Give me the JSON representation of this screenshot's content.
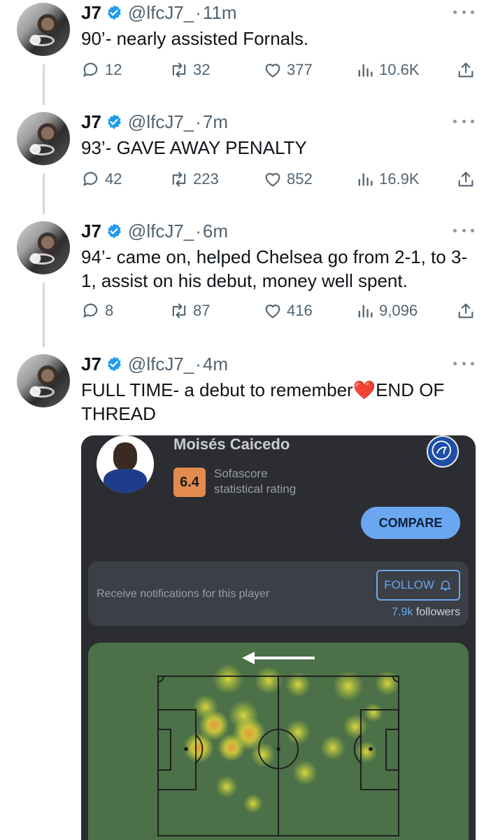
{
  "tweets": [
    {
      "name": "J7",
      "handle": "@lfcJ7_",
      "sep": "·",
      "time": "11m",
      "text": "90’- nearly assisted Fornals.",
      "replies": "12",
      "retweets": "32",
      "likes": "377",
      "views": "10.6K"
    },
    {
      "name": "J7",
      "handle": "@lfcJ7_",
      "sep": "·",
      "time": "7m",
      "text": "93’- GAVE AWAY PENALTY",
      "replies": "42",
      "retweets": "223",
      "likes": "852",
      "views": "16.9K"
    },
    {
      "name": "J7",
      "handle": "@lfcJ7_",
      "sep": "·",
      "time": "6m",
      "text": "94’- came on, helped Chelsea go from 2-1, to 3-1, assist on his debut, money well spent.",
      "replies": "8",
      "retweets": "87",
      "likes": "416",
      "views": "9,096"
    },
    {
      "name": "J7",
      "handle": "@lfcJ7_",
      "sep": "·",
      "time": "4m",
      "text_before": "FULL TIME- a debut to remember",
      "emoji": "❤️",
      "text_after": "END OF THREAD"
    }
  ],
  "card": {
    "player_name": "Moisés Caicedo",
    "rating": "6.4",
    "rating_label_line1": "Sofascore",
    "rating_label_line2": "statistical rating",
    "compare_label": "COMPARE",
    "notif_text": "Receive notifications for this player",
    "follow_label": "FOLLOW",
    "followers_count": "7.9k",
    "followers_label": "followers"
  },
  "colors": {
    "verified": "#1d9bf0",
    "card_bg": "#2b2d33",
    "pitch": "#4c7048",
    "accent": "#6aa7f0",
    "rating": "#e58a4e"
  }
}
